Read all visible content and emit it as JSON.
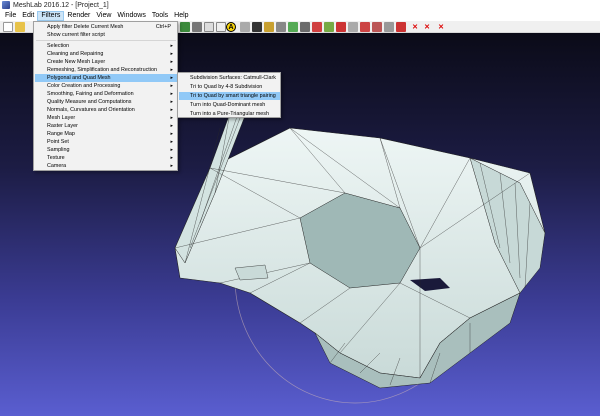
{
  "window": {
    "title": "MeshLab 2016.12 - [Project_1]"
  },
  "menubar": {
    "items": [
      "File",
      "Edit",
      "Filters",
      "Render",
      "View",
      "Windows",
      "Tools",
      "Help"
    ]
  },
  "filters_menu": {
    "header_items": [
      {
        "label": "Apply filter Delete Current Mesh",
        "shortcut": "Ctrl+P"
      },
      {
        "label": "Show current filter script",
        "shortcut": ""
      }
    ],
    "items": [
      {
        "label": "Selection"
      },
      {
        "label": "Cleaning and Repairing"
      },
      {
        "label": "Create New Mesh Layer"
      },
      {
        "label": "Remeshing, Simplification and Reconstruction"
      },
      {
        "label": "Polygonal and Quad Mesh"
      },
      {
        "label": "Color Creation and Processing"
      },
      {
        "label": "Smoothing, Fairing and Deformation"
      },
      {
        "label": "Quality Measure and Computations"
      },
      {
        "label": "Normals, Curvatures and Orientation"
      },
      {
        "label": "Mesh Layer"
      },
      {
        "label": "Raster Layer"
      },
      {
        "label": "Range Map"
      },
      {
        "label": "Point Set"
      },
      {
        "label": "Sampling"
      },
      {
        "label": "Texture"
      },
      {
        "label": "Camera"
      }
    ]
  },
  "submenu": {
    "items": [
      {
        "label": "Subdivision Surfaces: Catmull-Clark"
      },
      {
        "label": "Tri to Quad by 4-8 Subdivision"
      },
      {
        "label": "Tri to Quad by smart triangle pairing"
      },
      {
        "label": "Turn into Quad-Dominant mesh"
      },
      {
        "label": "Turn into a Pure-Triangular mesh"
      }
    ]
  },
  "toolbar": {
    "icons": [
      "new-project-icon",
      "open-icon",
      "reload-icon",
      "save-icon",
      "snapshot-icon",
      "arrow-icon",
      "bounding-box-icon",
      "points-icon",
      "wireframe-icon",
      "hidden-lines-icon",
      "flat-shading-icon",
      "smooth-shading-icon",
      "texture-icon",
      "light-icon",
      "double-side-icon",
      "fancy-light-icon",
      "info-icon",
      "color-icon",
      "select-faces-icon",
      "select-vertices-icon",
      "measure-icon",
      "pick-icon",
      "paint-icon",
      "texture-paint-icon",
      "align-icon",
      "z-paint-icon",
      "select-conn-icon",
      "select-region-icon",
      "manipulator-icon",
      "delete-faces-icon",
      "delete-vertices-icon",
      "delete-all-icon"
    ],
    "info_glyph": "A"
  },
  "colors": {
    "menu_highlight": "#91c9f7",
    "mesh_fill": "#dfeceb",
    "mesh_edge": "#2a2a2a",
    "background_top": "#0b0b18",
    "background_bottom": "#5a5ed0"
  }
}
